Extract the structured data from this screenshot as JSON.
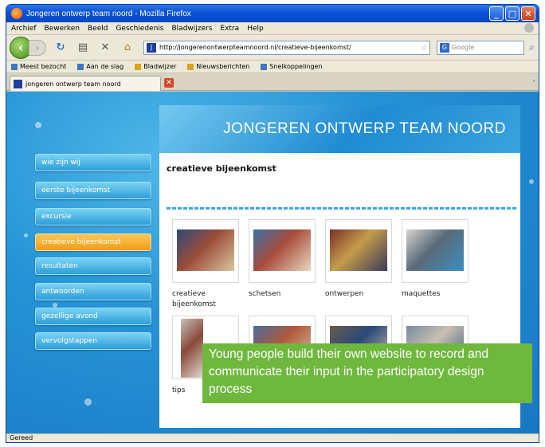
{
  "window": {
    "title": "Jongeren ontwerp team noord - Mozilla Firefox"
  },
  "menu": [
    "Archief",
    "Bewerken",
    "Beeld",
    "Geschiedenis",
    "Bladwijzers",
    "Extra",
    "Help"
  ],
  "navigation": {
    "url": "http://jongerenontwerpteamnoord.nl/creatieve-bijeenkomst/",
    "search_placeholder": "Google"
  },
  "bookmarks": [
    "Meest bezocht",
    "Aan de slag",
    "Bladwijzer",
    "Nieuwsberichten",
    "Snelkoppelingen"
  ],
  "tab": {
    "label": "jongeren ontwerp team noord"
  },
  "site": {
    "banner_title": "JONGEREN ONTWERP TEAM NOORD",
    "heading": "creatieve bijeenkomst",
    "nav": [
      {
        "label": "wie zijn wij",
        "active": false
      },
      {
        "label": "eerste bijeenkomst",
        "active": false
      },
      {
        "label": "excursie",
        "active": false
      },
      {
        "label": "creatieve bijeenkomst",
        "active": true
      },
      {
        "label": "resultaten",
        "active": false
      },
      {
        "label": "antwoorden",
        "active": false
      },
      {
        "label": "gezellige avond",
        "active": false
      },
      {
        "label": "vervolgstappen",
        "active": false
      }
    ],
    "gallery": [
      {
        "caption": "creatieve bijeenkomst",
        "colors": [
          "#2b4a7a",
          "#9b4c38",
          "#d9c6a0"
        ]
      },
      {
        "caption": "schetsen",
        "colors": [
          "#3a6fa8",
          "#a84b3a",
          "#e8d8c0"
        ]
      },
      {
        "caption": "ontwerpen",
        "colors": [
          "#7a2e28",
          "#c49c4a",
          "#3a3a5a"
        ]
      },
      {
        "caption": "maquettes",
        "colors": [
          "#d8d4cc",
          "#5a6a7a",
          "#3b8fc0"
        ]
      },
      {
        "caption": "tips",
        "colors": [
          "#c8c0b8",
          "#8a4a3a",
          "#e0d6ca"
        ]
      },
      {
        "caption": "",
        "colors": [
          "#4a6a9a",
          "#b05a3a",
          "#d8c8b0"
        ]
      },
      {
        "caption": "",
        "colors": [
          "#6a5a4a",
          "#2a4a7a",
          "#d0c0a8"
        ]
      },
      {
        "caption": "",
        "colors": [
          "#7a8aa0",
          "#c8c0b0",
          "#3a5a80"
        ]
      }
    ]
  },
  "overlay_text": "Young people build their own website to record and communicate their input in the participatory design process",
  "status": "Gereed"
}
